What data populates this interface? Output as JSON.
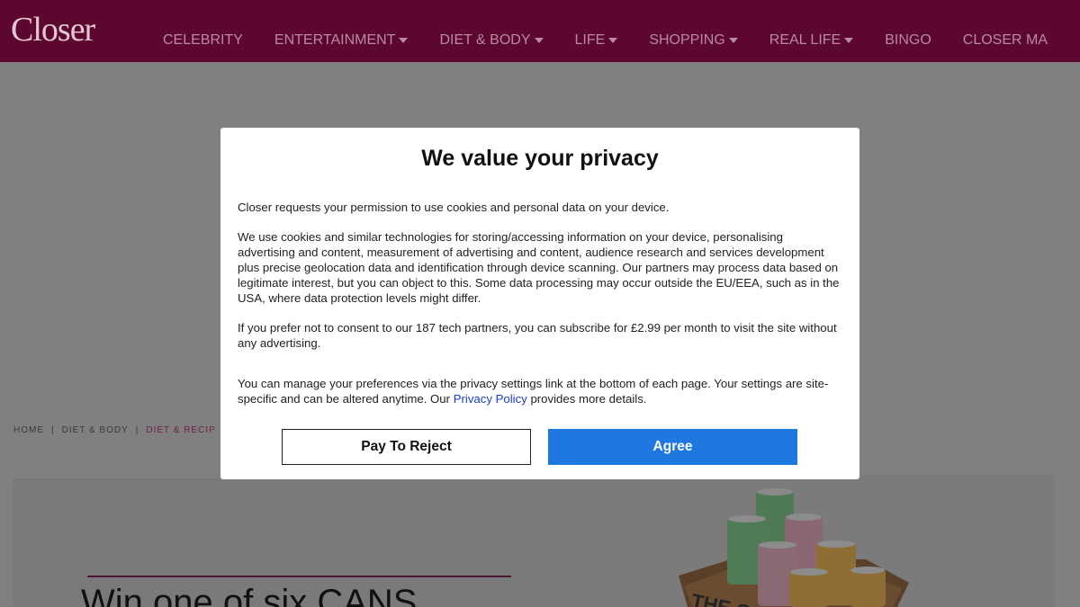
{
  "header": {
    "logo": "Closer",
    "nav": [
      {
        "label": "CELEBRITY",
        "dropdown": false
      },
      {
        "label": "ENTERTAINMENT",
        "dropdown": true
      },
      {
        "label": "DIET & BODY",
        "dropdown": true
      },
      {
        "label": "LIFE",
        "dropdown": true
      },
      {
        "label": "SHOPPING",
        "dropdown": true
      },
      {
        "label": "REAL LIFE",
        "dropdown": true
      },
      {
        "label": "BINGO",
        "dropdown": false
      },
      {
        "label": "CLOSER MA",
        "dropdown": false
      }
    ]
  },
  "breadcrumb": {
    "home": "HOME",
    "separator": "|",
    "section": "DIET & BODY",
    "current": "DIET & RECIP"
  },
  "article": {
    "title": "Win one of six CANS"
  },
  "modal": {
    "title": "We value your privacy",
    "intro": "Closer requests your permission to use cookies and personal data on your device.",
    "body": "We use cookies and similar technologies for storing/accessing information on your device, personalising advertising and content, measurement of advertising and content, audience research and services development plus precise geolocation data and identification through device scanning. Our partners may process data based on legitimate interest, but you can object to this. Some data processing may occur outside the EU/EEA, such as in the USA, where data protection levels might differ.",
    "subscribe": "If you prefer not to consent to our 187 tech partners, you can subscribe for £2.99 per month to visit the site without any advertising.",
    "manage_before": "You can manage your preferences via the privacy settings link at the bottom of each page. Your settings are site-specific and can be altered anytime. Our ",
    "policy_link": "Privacy Policy",
    "manage_after": " provides more details.",
    "reject_label": "Pay To Reject",
    "agree_label": "Agree"
  },
  "colors": {
    "header_bg": "#5c0630",
    "overlay": "#808080",
    "agree_button": "#1f78e0",
    "link": "#1a3fd0"
  }
}
